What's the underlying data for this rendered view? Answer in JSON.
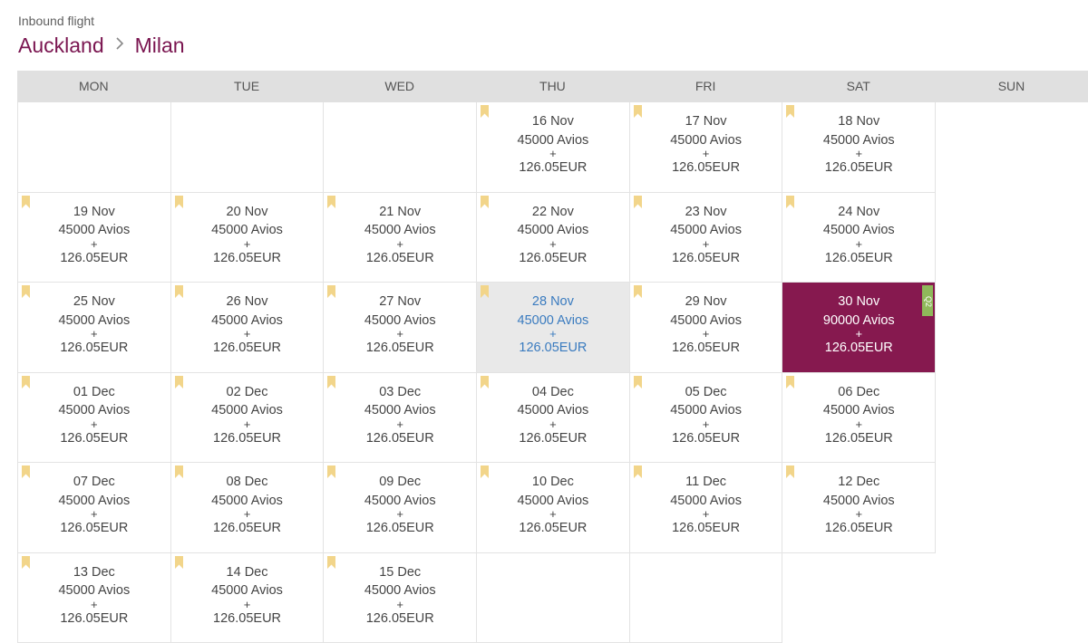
{
  "header": {
    "subtitle": "Inbound flight",
    "origin": "Auckland",
    "destination": "Milan"
  },
  "colors": {
    "accent": "#86194f",
    "bookmark": "#f2d58a",
    "hover_text": "#3a7bbf",
    "badge": "#8fb85a"
  },
  "weekdays": [
    "MON",
    "TUE",
    "WED",
    "THU",
    "FRI",
    "SAT",
    "SUN"
  ],
  "plus_sign": "+",
  "weeks": [
    [
      null,
      null,
      null,
      {
        "date": "16 Nov",
        "avios": "45000 Avios",
        "eur": "126.05EUR"
      },
      {
        "date": "17 Nov",
        "avios": "45000 Avios",
        "eur": "126.05EUR"
      },
      {
        "date": "18 Nov",
        "avios": "45000 Avios",
        "eur": "126.05EUR"
      },
      {
        "date": "19 Nov",
        "avios": "45000 Avios",
        "eur": "126.05EUR"
      }
    ],
    [
      {
        "date": "20 Nov",
        "avios": "45000 Avios",
        "eur": "126.05EUR"
      },
      {
        "date": "21 Nov",
        "avios": "45000 Avios",
        "eur": "126.05EUR"
      },
      {
        "date": "22 Nov",
        "avios": "45000 Avios",
        "eur": "126.05EUR"
      },
      {
        "date": "23 Nov",
        "avios": "45000 Avios",
        "eur": "126.05EUR"
      },
      {
        "date": "24 Nov",
        "avios": "45000 Avios",
        "eur": "126.05EUR"
      },
      {
        "date": "25 Nov",
        "avios": "45000 Avios",
        "eur": "126.05EUR"
      },
      {
        "date": "26 Nov",
        "avios": "45000 Avios",
        "eur": "126.05EUR"
      }
    ],
    [
      {
        "date": "27 Nov",
        "avios": "45000 Avios",
        "eur": "126.05EUR"
      },
      {
        "date": "28 Nov",
        "avios": "45000 Avios",
        "eur": "126.05EUR",
        "state": "hover"
      },
      {
        "date": "29 Nov",
        "avios": "45000 Avios",
        "eur": "126.05EUR"
      },
      {
        "date": "30 Nov",
        "avios": "90000 Avios",
        "eur": "126.05EUR",
        "state": "selected",
        "badge": "Q2"
      },
      {
        "date": "01 Dec",
        "avios": "45000 Avios",
        "eur": "126.05EUR"
      },
      {
        "date": "02 Dec",
        "avios": "45000 Avios",
        "eur": "126.05EUR"
      },
      {
        "date": "03 Dec",
        "avios": "45000 Avios",
        "eur": "126.05EUR"
      }
    ],
    [
      {
        "date": "04 Dec",
        "avios": "45000 Avios",
        "eur": "126.05EUR"
      },
      {
        "date": "05 Dec",
        "avios": "45000 Avios",
        "eur": "126.05EUR"
      },
      {
        "date": "06 Dec",
        "avios": "45000 Avios",
        "eur": "126.05EUR"
      },
      {
        "date": "07 Dec",
        "avios": "45000 Avios",
        "eur": "126.05EUR"
      },
      {
        "date": "08 Dec",
        "avios": "45000 Avios",
        "eur": "126.05EUR"
      },
      {
        "date": "09 Dec",
        "avios": "45000 Avios",
        "eur": "126.05EUR"
      },
      {
        "date": "10 Dec",
        "avios": "45000 Avios",
        "eur": "126.05EUR"
      }
    ],
    [
      {
        "date": "11 Dec",
        "avios": "45000 Avios",
        "eur": "126.05EUR"
      },
      {
        "date": "12 Dec",
        "avios": "45000 Avios",
        "eur": "126.05EUR"
      },
      {
        "date": "13 Dec",
        "avios": "45000 Avios",
        "eur": "126.05EUR"
      },
      {
        "date": "14 Dec",
        "avios": "45000 Avios",
        "eur": "126.05EUR"
      },
      {
        "date": "15 Dec",
        "avios": "45000 Avios",
        "eur": "126.05EUR"
      },
      null,
      null
    ]
  ]
}
